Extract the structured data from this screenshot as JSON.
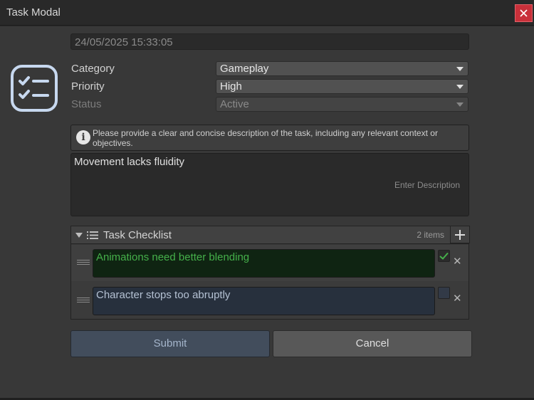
{
  "window": {
    "title": "Task Modal"
  },
  "form": {
    "date_value": "24/05/2025 15:33:05",
    "category": {
      "label": "Category",
      "value": "Gameplay"
    },
    "priority": {
      "label": "Priority",
      "value": "High"
    },
    "status": {
      "label": "Status",
      "value": "Active"
    },
    "help_text": "Please provide a clear and concise description of the task, including any relevant context or objectives.",
    "description": {
      "value": "Movement lacks fluidity",
      "placeholder": "Enter Description"
    }
  },
  "checklist": {
    "title": "Task Checklist",
    "count": "2 items",
    "items": [
      {
        "text": "Animations need better blending",
        "checked": true
      },
      {
        "text": "Character stops too abruptly",
        "checked": false
      }
    ]
  },
  "buttons": {
    "submit": "Submit",
    "cancel": "Cancel"
  },
  "icons": {
    "close": "close-icon",
    "app": "checklist-icon",
    "info": "info-icon",
    "fold": "triangle-down-icon",
    "list": "list-icon",
    "add": "plus-icon",
    "drag": "drag-handle-icon",
    "check": "checkmark-icon",
    "remove": "x-icon"
  },
  "colors": {
    "accent_red": "#c9303a",
    "checked_green": "#45b04a",
    "submit_blue": "#424d5c"
  }
}
